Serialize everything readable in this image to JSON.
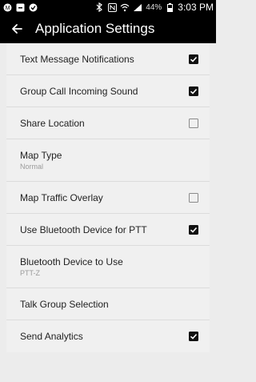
{
  "status_bar": {
    "left_icons": [
      "badge-icon",
      "gallery-icon",
      "shield-icon"
    ],
    "right_icons": [
      "bluetooth-icon",
      "nfc-icon",
      "wifi-icon",
      "signal-icon",
      "battery-icon"
    ],
    "battery_text": "44%",
    "time": "3:03 PM"
  },
  "app_bar": {
    "back_icon": "arrow-left-icon",
    "title": "Application Settings"
  },
  "settings": [
    {
      "label": "Text Message Notifications",
      "checked": true
    },
    {
      "label": "Group Call Incoming Sound",
      "checked": true
    },
    {
      "label": "Share Location",
      "checked": false
    },
    {
      "label": "Map Type",
      "value": "Normal"
    },
    {
      "label": "Map Traffic Overlay",
      "checked": false
    },
    {
      "label": "Use Bluetooth Device for PTT",
      "checked": true
    },
    {
      "label": "Bluetooth Device to Use",
      "value": "PTT-Z"
    },
    {
      "label": "Talk Group Selection"
    },
    {
      "label": "Send Analytics",
      "checked": true
    }
  ]
}
